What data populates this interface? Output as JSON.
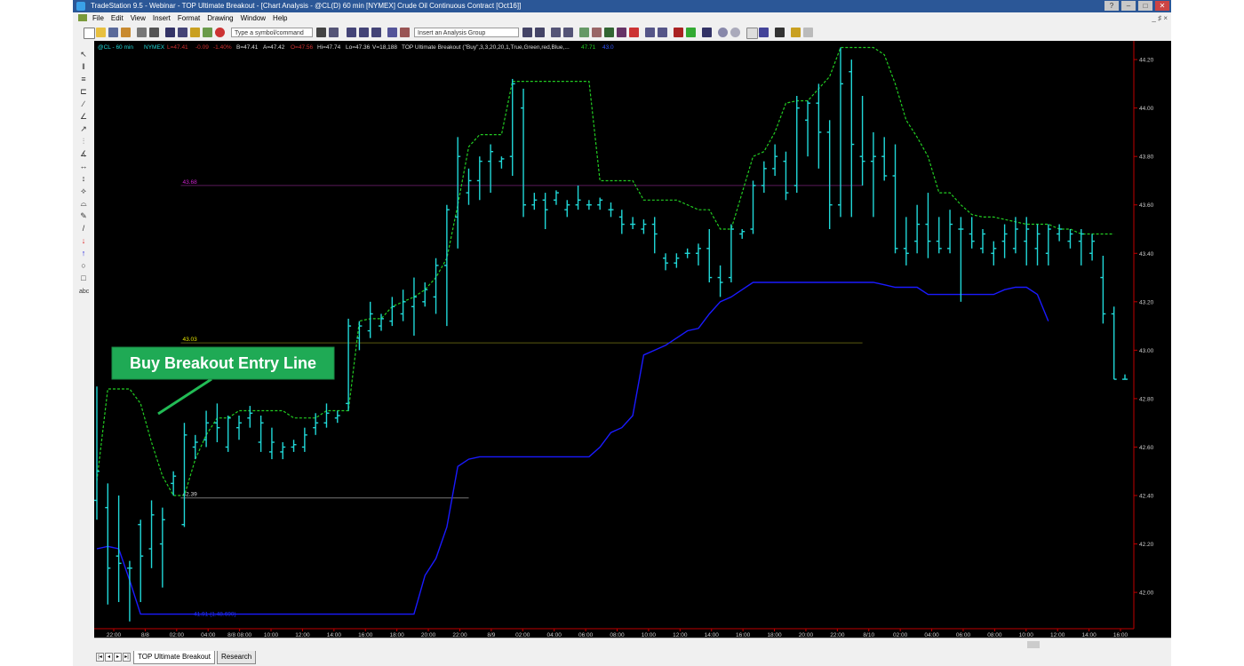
{
  "window": {
    "title": "TradeStation 9.5 - Webinar - TOP Ultimate Breakout - [Chart Analysis - @CL(D) 60 min [NYMEX] Crude Oil Continuous Contract [Oct16]]",
    "mdi_controls": "_ ♯ ×"
  },
  "menu": [
    "File",
    "Edit",
    "View",
    "Insert",
    "Format",
    "Drawing",
    "Window",
    "Help"
  ],
  "toolbar": {
    "symbol_placeholder": "Type a symbol/command",
    "analysis_group_placeholder": "Insert an Analysis Group"
  },
  "chart_header": {
    "symbol": "@CL - 60 min",
    "exchange": "NYMEX",
    "last": "L=47.41",
    "change": "-0.09",
    "change_pct": "-1.40%",
    "bid": "B=47.41",
    "ask": "A=47.42",
    "open": "O=47.56",
    "high": "Hi=47.74",
    "low": "Lo=47.36",
    "volume": "V=18,188",
    "indicator": "TOP Ultimate Breakout (\"Buy\",3,3,20,20,1,True,Green,red,Blue,...",
    "indicator_value": "47.71",
    "indicator_value2": "43.0"
  },
  "annotation": {
    "text": "Buy Breakout Entry Line",
    "bg": "#1faa55"
  },
  "levels": [
    {
      "label": "43.68",
      "value": 43.68,
      "color": "#cc22cc",
      "line": "#5a1a5a",
      "from": 8,
      "to": 70
    },
    {
      "label": "43.03",
      "value": 43.03,
      "color": "#e6e600",
      "line": "#5a5a10",
      "from": 8,
      "to": 70
    },
    {
      "label": "42.39",
      "value": 42.39,
      "color": "#dddddd",
      "line": "#777777",
      "from": 8,
      "to": 34
    }
  ],
  "stop_label": "41.91 (1.48.690)",
  "price_axis": [
    "44.20",
    "44.00",
    "43.80",
    "43.60",
    "43.40",
    "43.20",
    "43.00",
    "42.80",
    "42.60",
    "42.40",
    "42.20",
    "42.00"
  ],
  "time_axis": [
    "22:00",
    "8/8",
    "02:00",
    "04:00",
    "8/8  08:00",
    "10:00",
    "12:00",
    "14:00",
    "16:00",
    "18:00",
    "20:00",
    "22:00",
    "8/9",
    "02:00",
    "04:00",
    "06:00",
    "08:00",
    "10:00",
    "12:00",
    "14:00",
    "16:00",
    "18:00",
    "20:00",
    "22:00",
    "8/10",
    "02:00",
    "04:00",
    "06:00",
    "08:00",
    "10:00",
    "12:00",
    "14:00",
    "16:00"
  ],
  "tabs": [
    "TOP Ultimate Breakout",
    "Research"
  ],
  "colors": {
    "bars": "#20d8d8",
    "breakout_line": "#22cc22",
    "stop_line": "#1a1aff",
    "axis_text": "#cccccc",
    "axis_line": "#c00000"
  },
  "chart_data": {
    "type": "ohlc",
    "y_axis_range": [
      41.85,
      44.27
    ],
    "bars": [
      [
        42.85,
        42.3,
        42.38,
        42.5
      ],
      [
        42.45,
        41.95,
        42.35,
        42.1
      ],
      [
        42.4,
        41.96,
        42.15,
        42.12
      ],
      [
        42.13,
        41.88,
        42.1,
        42.1
      ],
      [
        42.3,
        41.96,
        42.28,
        42.15
      ],
      [
        42.38,
        42.1,
        42.18,
        42.32
      ],
      [
        42.35,
        42.02,
        42.2,
        42.3
      ],
      [
        42.5,
        42.4,
        42.45,
        42.48
      ],
      [
        42.7,
        42.27,
        42.28,
        42.65
      ],
      [
        42.65,
        42.55,
        42.6,
        42.62
      ],
      [
        42.75,
        42.6,
        42.63,
        42.7
      ],
      [
        42.78,
        42.62,
        42.7,
        42.68
      ],
      [
        42.73,
        42.58,
        42.6,
        42.72
      ],
      [
        42.73,
        42.63,
        42.68,
        42.7
      ],
      [
        42.77,
        42.68,
        42.72,
        42.74
      ],
      [
        42.73,
        42.58,
        42.62,
        42.7
      ],
      [
        42.68,
        42.55,
        42.58,
        42.62
      ],
      [
        42.62,
        42.55,
        42.58,
        42.6
      ],
      [
        42.63,
        42.58,
        42.6,
        42.61
      ],
      [
        42.68,
        42.58,
        42.6,
        42.65
      ],
      [
        42.74,
        42.65,
        42.68,
        42.7
      ],
      [
        42.78,
        42.68,
        42.7,
        42.74
      ],
      [
        42.75,
        42.7,
        42.72,
        42.73
      ],
      [
        43.13,
        42.75,
        42.78,
        43.1
      ],
      [
        43.12,
        43.0,
        43.05,
        43.1
      ],
      [
        43.2,
        43.05,
        43.08,
        43.15
      ],
      [
        43.15,
        43.08,
        43.1,
        43.13
      ],
      [
        43.22,
        43.1,
        43.12,
        43.18
      ],
      [
        43.25,
        43.12,
        43.15,
        43.2
      ],
      [
        43.3,
        43.06,
        43.18,
        43.22
      ],
      [
        43.28,
        43.18,
        43.2,
        43.25
      ],
      [
        43.38,
        43.15,
        43.22,
        43.35
      ],
      [
        43.6,
        43.1,
        43.35,
        43.58
      ],
      [
        43.88,
        43.42,
        43.55,
        43.8
      ],
      [
        43.75,
        43.6,
        43.65,
        43.7
      ],
      [
        43.8,
        43.62,
        43.7,
        43.78
      ],
      [
        43.85,
        43.65,
        43.78,
        43.82
      ],
      [
        43.8,
        43.75,
        43.78,
        43.79
      ],
      [
        44.12,
        43.72,
        43.8,
        44.1
      ],
      [
        44.08,
        43.55,
        44.0,
        43.6
      ],
      [
        43.65,
        43.58,
        43.6,
        43.62
      ],
      [
        43.65,
        43.5,
        43.62,
        43.58
      ],
      [
        43.66,
        43.6,
        43.62,
        43.65
      ],
      [
        43.62,
        43.55,
        43.58,
        43.6
      ],
      [
        43.68,
        43.58,
        43.6,
        43.62
      ],
      [
        43.62,
        43.58,
        43.6,
        43.6
      ],
      [
        43.63,
        43.58,
        43.6,
        43.62
      ],
      [
        43.61,
        43.55,
        43.58,
        43.58
      ],
      [
        43.58,
        43.48,
        43.55,
        43.52
      ],
      [
        43.55,
        43.5,
        43.52,
        43.52
      ],
      [
        43.54,
        43.48,
        43.5,
        43.52
      ],
      [
        43.55,
        43.4,
        43.52,
        43.48
      ],
      [
        43.4,
        43.33,
        43.38,
        43.36
      ],
      [
        43.4,
        43.34,
        43.36,
        43.38
      ],
      [
        43.42,
        43.38,
        43.4,
        43.4
      ],
      [
        43.44,
        43.35,
        43.4,
        43.42
      ],
      [
        43.5,
        43.28,
        43.42,
        43.3
      ],
      [
        43.35,
        43.22,
        43.3,
        43.28
      ],
      [
        43.52,
        43.28,
        43.3,
        43.5
      ],
      [
        43.5,
        43.46,
        43.48,
        43.49
      ],
      [
        43.7,
        43.48,
        43.5,
        43.68
      ],
      [
        43.78,
        43.65,
        43.68,
        43.75
      ],
      [
        43.85,
        43.72,
        43.75,
        43.8
      ],
      [
        43.82,
        43.62,
        43.78,
        43.65
      ],
      [
        44.05,
        43.65,
        43.68,
        44.0
      ],
      [
        44.03,
        43.8,
        43.95,
        44.02
      ],
      [
        44.1,
        43.75,
        44.02,
        43.9
      ],
      [
        43.95,
        43.5,
        43.9,
        43.6
      ],
      [
        44.25,
        43.55,
        43.6,
        44.1
      ],
      [
        44.2,
        43.55,
        44.15,
        43.85
      ],
      [
        44.05,
        43.68,
        43.8,
        43.78
      ],
      [
        43.9,
        43.55,
        43.78,
        43.8
      ],
      [
        43.88,
        43.7,
        43.8,
        43.72
      ],
      [
        43.85,
        43.4,
        43.72,
        43.42
      ],
      [
        43.55,
        43.35,
        43.42,
        43.4
      ],
      [
        43.6,
        43.4,
        43.45,
        43.52
      ],
      [
        43.65,
        43.38,
        43.52,
        43.45
      ],
      [
        43.55,
        43.4,
        43.45,
        43.42
      ],
      [
        43.58,
        43.4,
        43.42,
        43.52
      ],
      [
        43.55,
        43.2,
        43.5,
        43.5
      ],
      [
        43.55,
        43.42,
        43.48,
        43.45
      ],
      [
        43.5,
        43.4,
        43.42,
        43.48
      ],
      [
        43.45,
        43.35,
        43.4,
        43.42
      ],
      [
        43.52,
        43.38,
        43.45,
        43.48
      ],
      [
        43.55,
        43.4,
        43.42,
        43.5
      ],
      [
        43.55,
        43.35,
        43.45,
        43.5
      ],
      [
        43.52,
        43.35,
        43.42,
        43.48
      ],
      [
        43.52,
        43.35,
        43.4,
        43.5
      ],
      [
        43.52,
        43.45,
        43.48,
        43.5
      ],
      [
        43.5,
        43.42,
        43.45,
        43.48
      ],
      [
        43.5,
        43.35,
        43.45,
        43.48
      ],
      [
        43.48,
        43.37,
        43.4,
        43.45
      ],
      [
        43.39,
        43.11,
        43.3,
        43.15
      ],
      [
        43.18,
        42.88,
        43.15,
        42.88
      ],
      [
        42.9,
        42.88,
        42.88,
        42.88
      ]
    ],
    "breakout_line": [
      42.46,
      42.84,
      42.84,
      42.84,
      42.78,
      42.62,
      42.48,
      42.4,
      42.4,
      42.55,
      42.65,
      42.72,
      42.72,
      42.75,
      42.75,
      42.75,
      42.75,
      42.75,
      42.72,
      42.72,
      42.72,
      42.75,
      42.75,
      42.75,
      43.12,
      43.13,
      43.13,
      43.18,
      43.2,
      43.22,
      43.25,
      43.3,
      43.38,
      43.6,
      43.84,
      43.89,
      43.89,
      43.89,
      44.11,
      44.11,
      44.11,
      44.11,
      44.11,
      44.11,
      44.11,
      44.11,
      43.7,
      43.7,
      43.7,
      43.7,
      43.62,
      43.62,
      43.62,
      43.62,
      43.6,
      43.58,
      43.58,
      43.5,
      43.5,
      43.65,
      43.8,
      43.82,
      43.9,
      44.02,
      44.03,
      44.03,
      44.08,
      44.13,
      44.25,
      44.25,
      44.25,
      44.25,
      44.22,
      44.1,
      43.95,
      43.88,
      43.8,
      43.65,
      43.65,
      43.6,
      43.56,
      43.55,
      43.55,
      43.54,
      43.53,
      43.52,
      43.52,
      43.52,
      43.5,
      43.5,
      43.48,
      43.48,
      43.48,
      43.48
    ],
    "stop_line": [
      42.18,
      42.19,
      42.18,
      42.05,
      41.91,
      41.91,
      41.91,
      41.91,
      41.91,
      41.91,
      41.91,
      41.91,
      41.91,
      41.91,
      41.91,
      41.91,
      41.91,
      41.91,
      41.91,
      41.91,
      41.91,
      41.91,
      41.91,
      41.91,
      41.91,
      41.91,
      41.91,
      41.91,
      41.91,
      41.91,
      42.07,
      42.14,
      42.27,
      42.52,
      42.55,
      42.56,
      42.56,
      42.56,
      42.56,
      42.56,
      42.56,
      42.56,
      42.56,
      42.56,
      42.56,
      42.56,
      42.6,
      42.66,
      42.68,
      42.73,
      42.98,
      43.0,
      43.02,
      43.05,
      43.08,
      43.09,
      43.15,
      43.2,
      43.22,
      43.25,
      43.28,
      43.28,
      43.28,
      43.28,
      43.28,
      43.28,
      43.28,
      43.28,
      43.28,
      43.28,
      43.28,
      43.28,
      43.27,
      43.26,
      43.26,
      43.26,
      43.23,
      43.23,
      43.23,
      43.23,
      43.23,
      43.23,
      43.23,
      43.25,
      43.26,
      43.26,
      43.23,
      43.12
    ]
  }
}
